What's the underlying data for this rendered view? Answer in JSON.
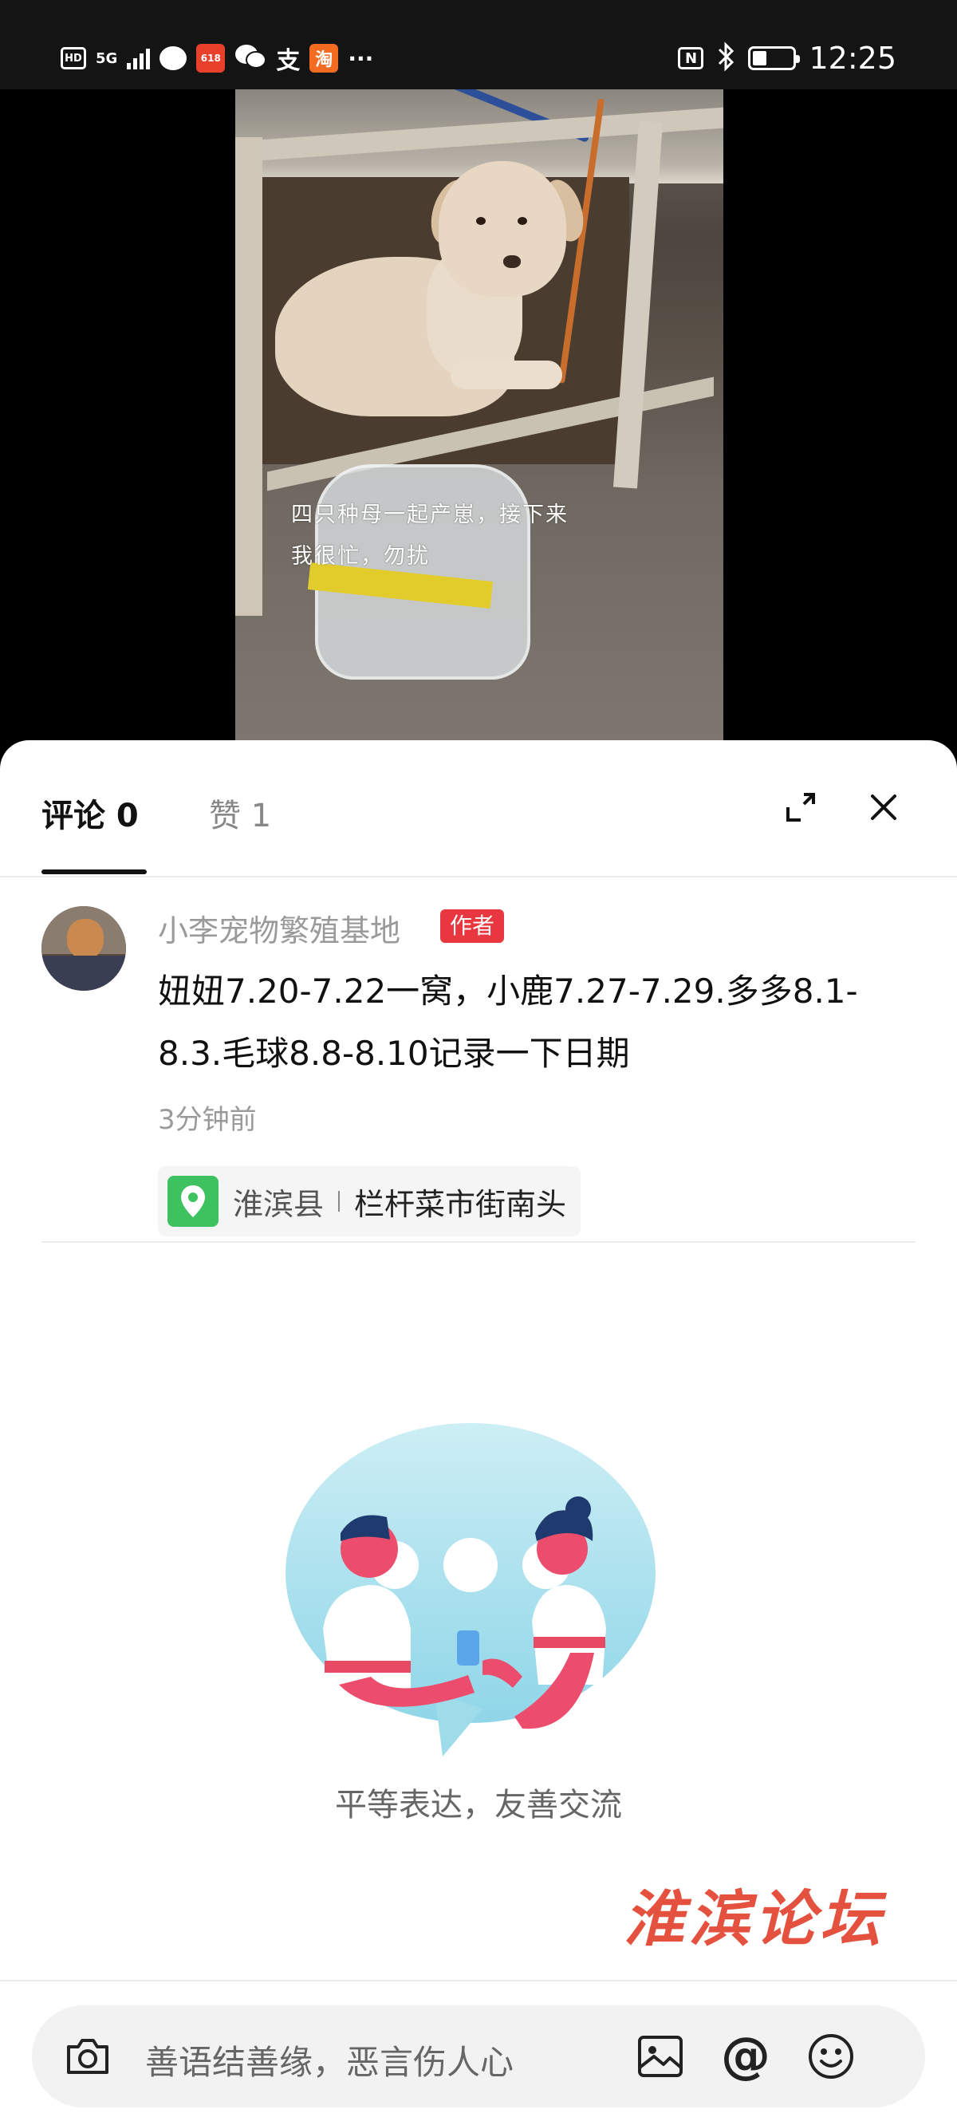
{
  "status_bar": {
    "hd": "HD",
    "network": "5G",
    "app_badge": "618",
    "pay_label": "支",
    "taobao_label": "淘",
    "more": "···",
    "nfc": "N",
    "battery_level": 0.3,
    "time": "12:25"
  },
  "video": {
    "caption_line1": "四只种母一起产崽，接下来",
    "caption_line2": "我很忙，勿扰"
  },
  "tabs": {
    "comments": "评论 0",
    "likes": "赞 1"
  },
  "icons": {
    "expand": "expand-icon",
    "close": "close-icon",
    "location": "location-pin-icon",
    "camera": "camera-icon",
    "image": "image-icon",
    "at": "at-icon",
    "emoji": "emoji-icon"
  },
  "comment": {
    "author": "小李宠物繁殖基地",
    "badge": "作者",
    "text": "妞妞7.20-7.22一窝，小鹿7.27-7.29.多多8.1-8.3.毛球8.8-8.10记录一下日期",
    "time": "3分钟前",
    "location_district": "淮滨县",
    "location_place": "栏杆菜市街南头"
  },
  "empty_state": {
    "text": "平等表达，友善交流"
  },
  "watermark": "淮滨论坛",
  "input": {
    "placeholder": "善语结善缘，恶言伤人心",
    "at_symbol": "@"
  },
  "colors": {
    "accent_red": "#e8373e",
    "location_green": "#3ec260",
    "watermark_red": "#e4523f"
  }
}
